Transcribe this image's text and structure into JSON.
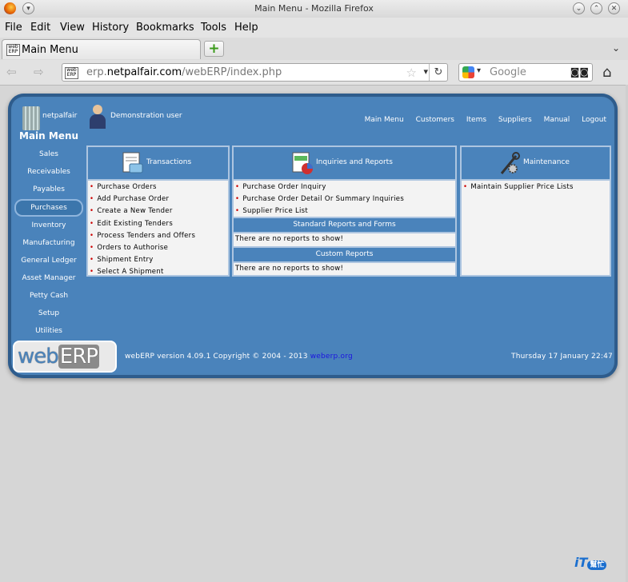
{
  "window": {
    "title": "Main Menu - Mozilla Firefox"
  },
  "menubar": [
    "File",
    "Edit",
    "View",
    "History",
    "Bookmarks",
    "Tools",
    "Help"
  ],
  "tab": {
    "label": "Main Menu"
  },
  "url": {
    "prefix": "erp.",
    "domain": "netpalfair.com",
    "path": "/webERP/index.php"
  },
  "search": {
    "placeholder": "Google"
  },
  "app": {
    "company": "netpalfair",
    "user": "Demonstration user",
    "topnav": [
      "Main Menu",
      "Customers",
      "Items",
      "Suppliers",
      "Manual",
      "Logout"
    ],
    "menu_title": "Main Menu",
    "sidebar": [
      "Sales",
      "Receivables",
      "Payables",
      "Purchases",
      "Inventory",
      "Manufacturing",
      "General Ledger",
      "Asset Manager",
      "Petty Cash",
      "Setup",
      "Utilities"
    ],
    "active_module": "Purchases",
    "transactions": {
      "title": "Transactions",
      "items": [
        "Purchase Orders",
        "Add Purchase Order",
        "Create a New Tender",
        "Edit Existing Tenders",
        "Process Tenders and Offers",
        "Orders to Authorise",
        "Shipment Entry",
        "Select A Shipment"
      ]
    },
    "inquiries": {
      "title": "Inquiries and Reports",
      "items": [
        "Purchase Order Inquiry",
        "Purchase Order Detail Or Summary Inquiries",
        "Supplier Price List"
      ],
      "standard_title": "Standard Reports and Forms",
      "standard_empty": "There are no reports to show!",
      "custom_title": "Custom Reports",
      "custom_empty": "There are no reports to show!"
    },
    "maintenance": {
      "title": "Maintenance",
      "items": [
        "Maintain Supplier Price Lists"
      ]
    },
    "footer": {
      "logo_web": "web",
      "logo_erp": "ERP",
      "version": "webERP version 4.09.1 Copyright © 2004 - 2013",
      "link": "weberp.org",
      "date": "Thursday 17 January 22:47"
    }
  },
  "watermark": {
    "main": "iT",
    "small": "幫忙"
  }
}
